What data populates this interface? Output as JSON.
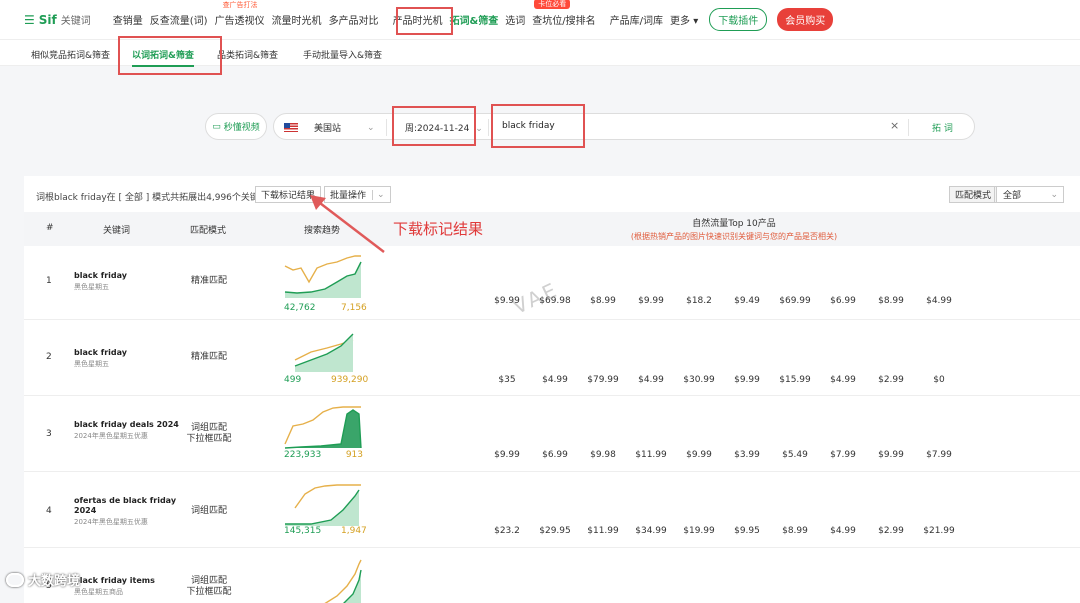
{
  "logo": {
    "brand": "Sif",
    "sub": "关键词"
  },
  "nav": [
    {
      "label": "查销量",
      "tag": ""
    },
    {
      "label": "反查流量(词)",
      "tag": ""
    },
    {
      "label": "广告透视仪",
      "tag": "查广告打法"
    },
    {
      "label": "流量时光机",
      "tag": ""
    },
    {
      "label": "多产品对比",
      "tag": ""
    },
    {
      "label": "产品时光机",
      "tag": ""
    },
    {
      "label": "拓词&筛查",
      "tag": ""
    },
    {
      "label": "选词",
      "tag": ""
    },
    {
      "label": "查坑位/搜排名",
      "tag": "卡位必看"
    },
    {
      "label": "产品库/词库",
      "tag": ""
    },
    {
      "label": "更多",
      "tag": ""
    }
  ],
  "download_plugin": "下载插件",
  "vip": "会员购买",
  "subtabs": [
    "相似竞品拓词&筛查",
    "以词拓词&筛查",
    "品类拓词&筛查",
    "手动批量导入&筛查"
  ],
  "search": {
    "video": "秒懂视频",
    "site": "美国站",
    "week": "周:2024-11-24",
    "keyword": "black friday",
    "clear": "×",
    "expand": "拓 词"
  },
  "toolbar": {
    "summary": "词根black friday在 [ 全部 ] 模式共拓展出4,996个关键词",
    "download_btn": "下载标记结果",
    "batch_btn": "批量操作",
    "match_label": "匹配模式",
    "match_value": "全部"
  },
  "headers": {
    "num": "#",
    "keyword": "关键词",
    "mode": "匹配模式",
    "trend": "搜索趋势",
    "top10": "自然流量Top 10产品",
    "top10_note": "(根据热销产品的图片快速识别关键词与您的产品是否相关)"
  },
  "annotation": "下载标记结果",
  "watermark": "VAE",
  "bottom_logo": "大数跨境",
  "rows": [
    {
      "num": "1",
      "kw": "black friday",
      "kw_sub": "黑色星期五",
      "mode": "精准匹配",
      "mode2": "",
      "low": "42,762",
      "high": "7,156",
      "prices": [
        "$9.99",
        "$69.98",
        "$8.99",
        "$9.99",
        "$18.2",
        "$9.49",
        "$69.99",
        "$6.99",
        "$8.99",
        "$4.99"
      ]
    },
    {
      "num": "2",
      "kw": "black friday",
      "kw_sub": "黑色星期五",
      "mode": "精准匹配",
      "mode2": "",
      "low": "499",
      "high": "939,290",
      "prices": [
        "$35",
        "$4.99",
        "$79.99",
        "$4.99",
        "$30.99",
        "$9.99",
        "$15.99",
        "$4.99",
        "$2.99",
        "$0"
      ]
    },
    {
      "num": "3",
      "kw": "black friday deals 2024",
      "kw_sub": "2024年黑色星期五优惠",
      "mode": "词组匹配",
      "mode2": "下拉框匹配",
      "low": "223,933",
      "high": "913",
      "prices": [
        "$9.99",
        "$6.99",
        "$9.98",
        "$11.99",
        "$9.99",
        "$3.99",
        "$5.49",
        "$7.99",
        "$9.99",
        "$7.99"
      ]
    },
    {
      "num": "4",
      "kw": "ofertas de black friday 2024",
      "kw_sub": "2024年黑色星期五优惠",
      "mode": "词组匹配",
      "mode2": "",
      "low": "145,315",
      "high": "1,947",
      "prices": [
        "$23.2",
        "$29.95",
        "$11.99",
        "$34.99",
        "$19.99",
        "$9.95",
        "$8.99",
        "$4.99",
        "$2.99",
        "$21.99"
      ]
    },
    {
      "num": "5",
      "kw": "black friday items",
      "kw_sub": "黑色星期五商品",
      "mode": "词组匹配",
      "mode2": "下拉框匹配",
      "low": "",
      "high": "",
      "prices": []
    }
  ]
}
